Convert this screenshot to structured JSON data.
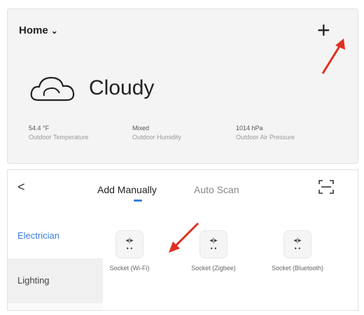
{
  "home": {
    "title": "Home",
    "chevron": "⌄",
    "add_icon": "+"
  },
  "weather": {
    "condition": "Cloudy",
    "stats": [
      {
        "value": "54.4 °F",
        "label": "Outdoor Temperature"
      },
      {
        "value": "Mixed",
        "label": "Outdoor Humidity"
      },
      {
        "value": "1014 hPa",
        "label": "Outdoor Air Pressure"
      }
    ]
  },
  "add_device": {
    "back_icon": "<",
    "tabs": [
      "Add Manually",
      "Auto Scan"
    ],
    "sidebar": [
      "Electrician",
      "Lighting"
    ],
    "devices": [
      {
        "name": "Socket (Wi-Fi)",
        "icon_top": "◂|▸",
        "icon_bot": "• •"
      },
      {
        "name": "Socket (Zigbee)",
        "icon_top": "◂|▸",
        "icon_bot": "• •"
      },
      {
        "name": "Socket (Bluetooth)",
        "icon_top": "◂|▸",
        "icon_bot": "• •"
      }
    ]
  },
  "colors": {
    "accent": "#3b7ddd",
    "annotation_arrow": "#e03020"
  }
}
